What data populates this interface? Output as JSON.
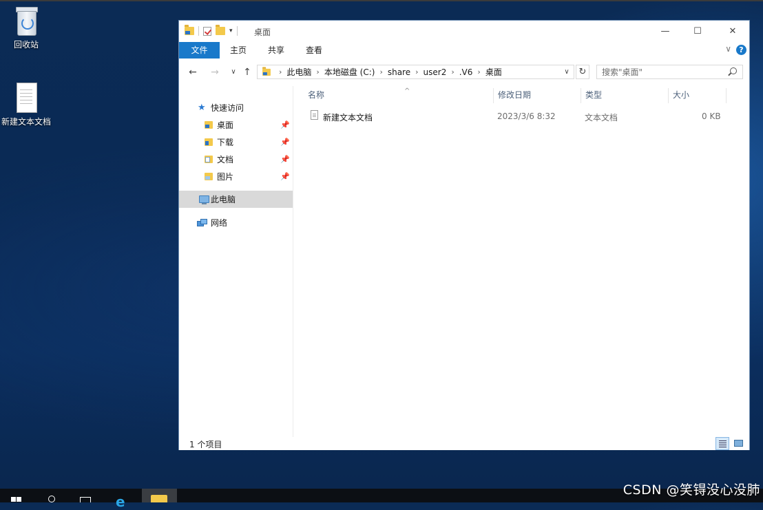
{
  "desktop": {
    "icons": [
      {
        "label": "回收站",
        "icon": "recycle-bin-icon"
      },
      {
        "label": "新建文本文档",
        "icon": "text-document-icon"
      }
    ]
  },
  "window": {
    "title": "桌面",
    "controls": {
      "minimize": "—",
      "maximize": "☐",
      "close": "✕"
    },
    "ribbon": {
      "tabs": [
        "文件",
        "主页",
        "共享",
        "查看"
      ],
      "expand": "∨",
      "help": "?"
    },
    "nav": {
      "back": "←",
      "forward": "→",
      "recent": "∨",
      "up": "↑",
      "breadcrumb": [
        "此电脑",
        "本地磁盘 (C:)",
        "share",
        "user2",
        ".V6",
        "桌面"
      ],
      "crumb_separator": "›",
      "refresh": "↻",
      "search_placeholder": "搜索\"桌面\""
    },
    "navpane": {
      "quick_access": "快速访问",
      "pinned": [
        "桌面",
        "下载",
        "文档",
        "图片"
      ],
      "this_pc": "此电脑",
      "network": "网络"
    },
    "columns": [
      "名称",
      "修改日期",
      "类型",
      "大小"
    ],
    "rows": [
      {
        "name": "新建文本文档",
        "modified": "2023/3/6 8:32",
        "type": "文本文档",
        "size": "0 KB"
      }
    ],
    "status": "1 个项目"
  },
  "watermark": "CSDN @笑锝没心没肺"
}
